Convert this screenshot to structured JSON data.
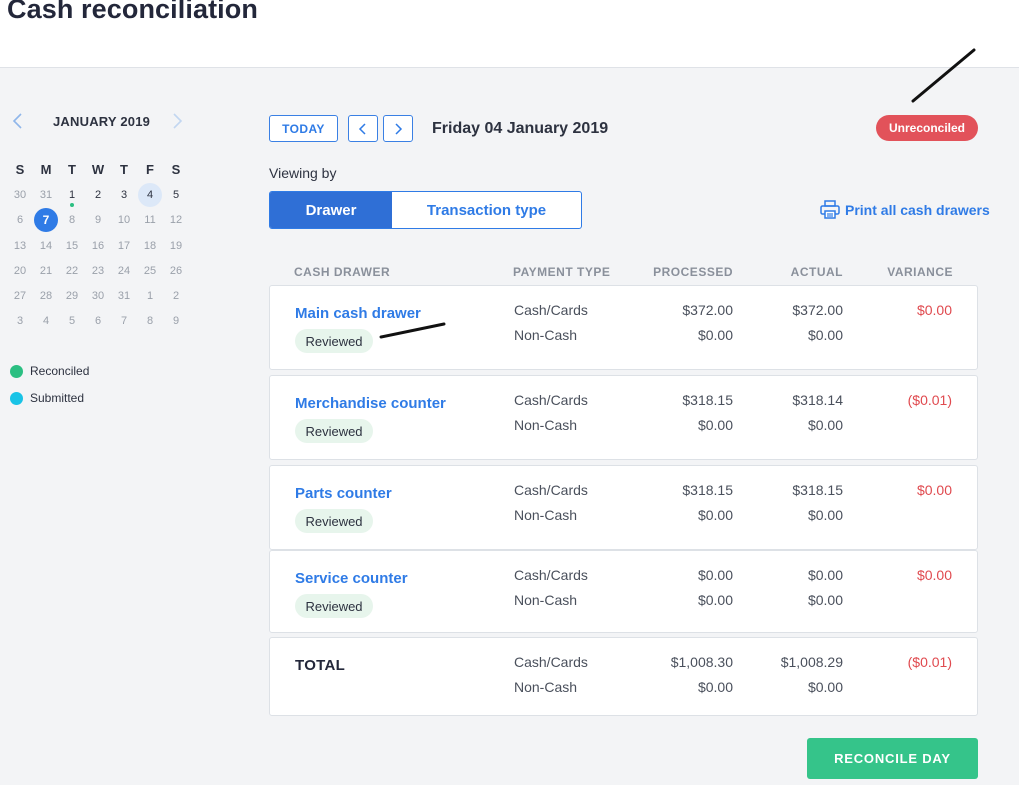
{
  "header": {
    "title": "Cash reconciliation"
  },
  "calendar": {
    "month_label": "JANUARY 2019",
    "weekdays": [
      "S",
      "M",
      "T",
      "W",
      "T",
      "F",
      "S"
    ],
    "weeks": [
      [
        "30",
        "31",
        "1",
        "2",
        "3",
        "4",
        "5"
      ],
      [
        "6",
        "7",
        "8",
        "9",
        "10",
        "11",
        "12"
      ],
      [
        "13",
        "14",
        "15",
        "16",
        "17",
        "18",
        "19"
      ],
      [
        "20",
        "21",
        "22",
        "23",
        "24",
        "25",
        "26"
      ],
      [
        "27",
        "28",
        "29",
        "30",
        "31",
        "1",
        "2"
      ],
      [
        "3",
        "4",
        "5",
        "6",
        "7",
        "8",
        "9"
      ]
    ],
    "selected_day": "7",
    "highlighted_day": "4",
    "reconciled_day": "1",
    "prev_icon": "chevron-left-icon",
    "next_icon": "chevron-right-icon"
  },
  "legend": {
    "items": [
      {
        "label": "Reconciled",
        "color": "#2bbf82"
      },
      {
        "label": "Submitted",
        "color": "#19c3e6"
      }
    ]
  },
  "toolbar": {
    "today_label": "TODAY",
    "date_label": "Friday 04 January 2019",
    "status_label": "Unreconciled"
  },
  "viewing": {
    "label": "Viewing by",
    "options": [
      "Drawer",
      "Transaction type"
    ],
    "active": "Drawer"
  },
  "print_label": "Print all cash drawers",
  "table": {
    "headers": {
      "drawer": "CASH DRAWER",
      "payment_type": "PAYMENT TYPE",
      "processed": "PROCESSED",
      "actual": "ACTUAL",
      "variance": "VARIANCE"
    },
    "rows": [
      {
        "name": "Main cash drawer",
        "status": "Reviewed",
        "lines": [
          {
            "type": "Cash/Cards",
            "processed": "$372.00",
            "actual": "$372.00",
            "variance": "$0.00"
          },
          {
            "type": "Non-Cash",
            "processed": "$0.00",
            "actual": "$0.00"
          }
        ]
      },
      {
        "name": "Merchandise counter",
        "status": "Reviewed",
        "lines": [
          {
            "type": "Cash/Cards",
            "processed": "$318.15",
            "actual": "$318.14",
            "variance": "($0.01)"
          },
          {
            "type": "Non-Cash",
            "processed": "$0.00",
            "actual": "$0.00"
          }
        ]
      },
      {
        "name": "Parts counter",
        "status": "Reviewed",
        "lines": [
          {
            "type": "Cash/Cards",
            "processed": "$318.15",
            "actual": "$318.15",
            "variance": "$0.00"
          },
          {
            "type": "Non-Cash",
            "processed": "$0.00",
            "actual": "$0.00"
          }
        ]
      },
      {
        "name": "Service counter",
        "status": "Reviewed",
        "lines": [
          {
            "type": "Cash/Cards",
            "processed": "$0.00",
            "actual": "$0.00",
            "variance": "$0.00"
          },
          {
            "type": "Non-Cash",
            "processed": "$0.00",
            "actual": "$0.00"
          }
        ]
      }
    ],
    "total": {
      "label": "TOTAL",
      "lines": [
        {
          "type": "Cash/Cards",
          "processed": "$1,008.30",
          "actual": "$1,008.29",
          "variance": "($0.01)"
        },
        {
          "type": "Non-Cash",
          "processed": "$0.00",
          "actual": "$0.00"
        }
      ]
    }
  },
  "reconcile_label": "RECONCILE DAY",
  "colors": {
    "accent": "#2f7be6",
    "danger": "#e2525a",
    "success": "#35c48a"
  }
}
